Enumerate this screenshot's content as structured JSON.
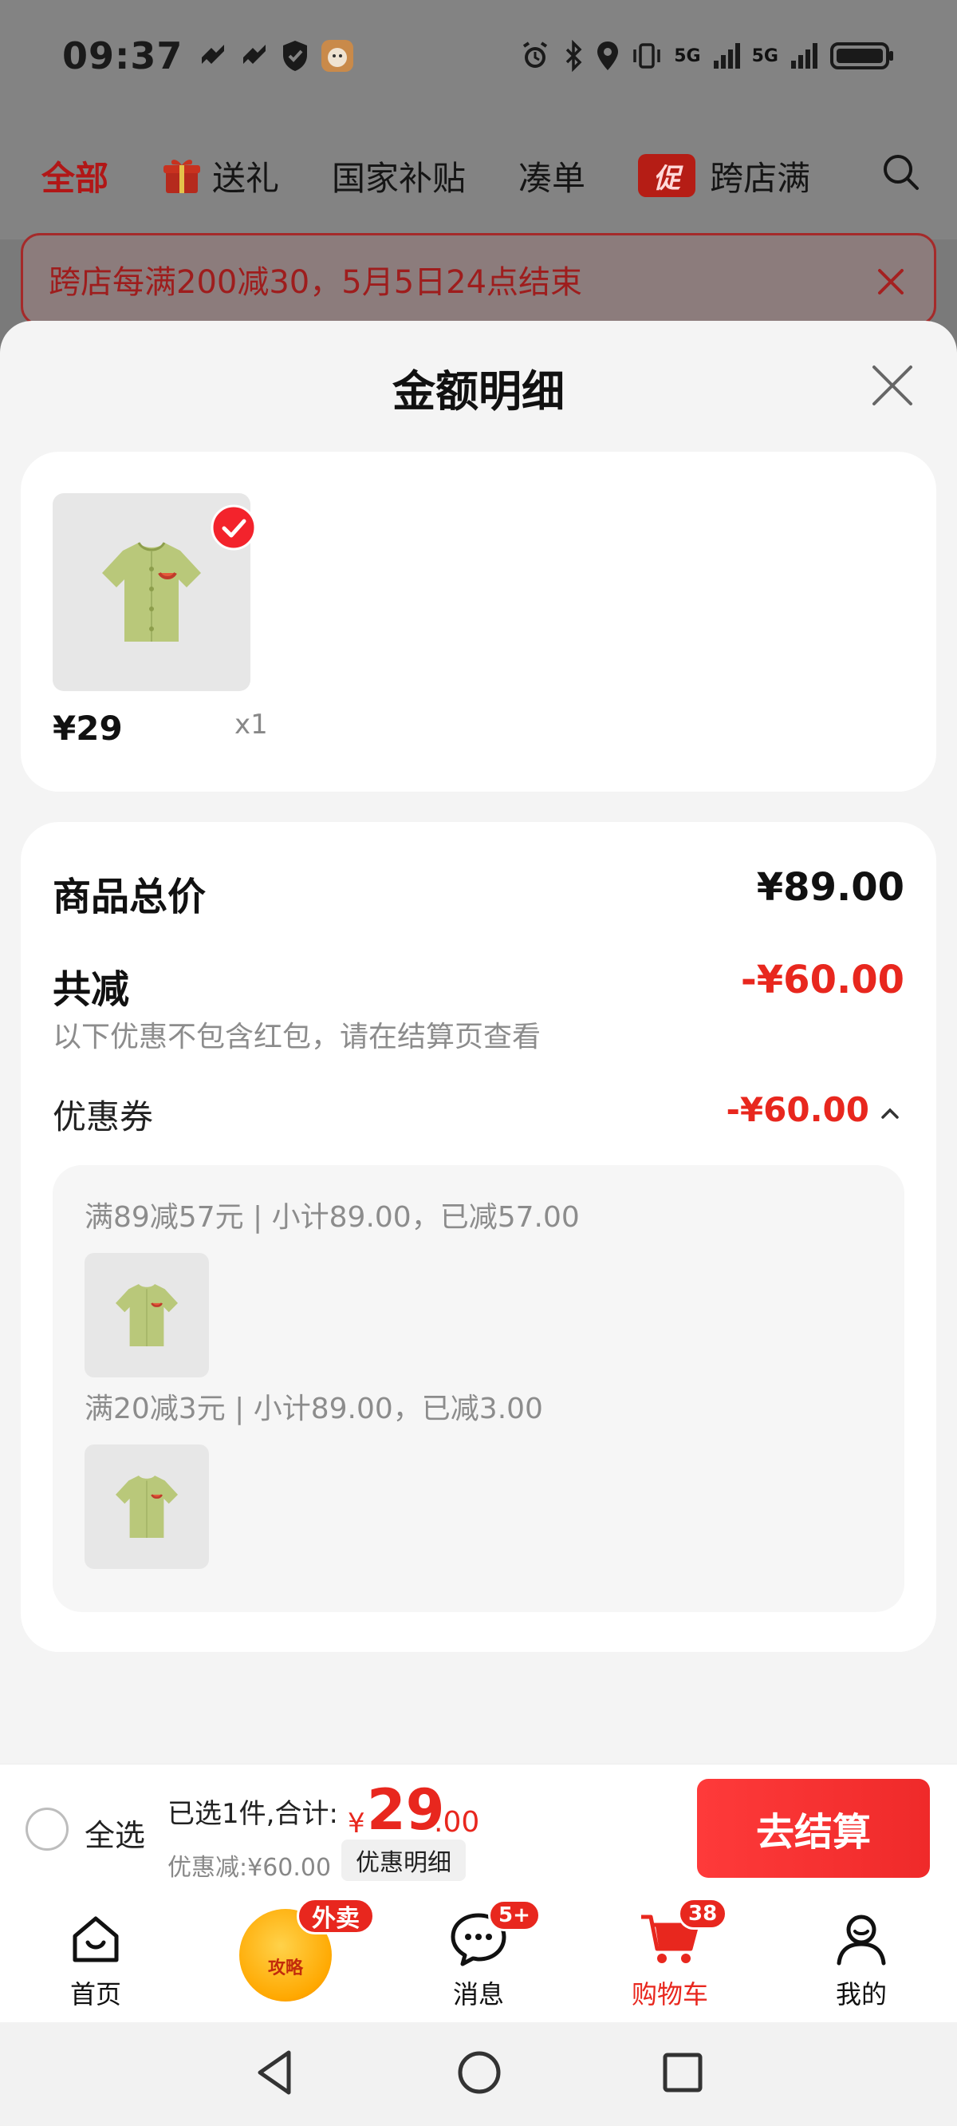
{
  "status_bar": {
    "time": "09:37",
    "network_1": "5G",
    "network_2": "5G"
  },
  "tabs": [
    {
      "label": "全部",
      "active": true
    },
    {
      "label": "送礼",
      "icon": "gift-icon"
    },
    {
      "label": "国家补贴"
    },
    {
      "label": "凑单"
    },
    {
      "label": "跨店满",
      "badge": "促"
    }
  ],
  "promo_banner": {
    "text": "跨店每满200减30，5月5日24点结束"
  },
  "sheet": {
    "title": "金额明细"
  },
  "product": {
    "price": "¥29",
    "quantity": "x1",
    "selected": true
  },
  "summary": {
    "total_label": "商品总价",
    "total_value": "¥89.00",
    "discount_label": "共减",
    "discount_value": "-¥60.00",
    "note": "以下优惠不包含红包，请在结算页查看",
    "coupon_label": "优惠券",
    "coupon_value": "-¥60.00"
  },
  "coupon_details": [
    {
      "rule": "满89减57元 | 小计89.00，已减57.00"
    },
    {
      "rule": "满20减3元 | 小计89.00，已减3.00"
    }
  ],
  "checkout": {
    "select_all_label": "全选",
    "selected_summary": "已选1件,合计:",
    "currency": "¥",
    "total_int": "29",
    "total_dec": ".00",
    "discount_summary": "优惠减:¥60.00",
    "detail_button": "优惠明细",
    "checkout_button": "去结算"
  },
  "bottom_nav": {
    "home": "首页",
    "promo_lantern_text": "攻略",
    "takeout_badge": "外卖",
    "messages": "消息",
    "messages_badge": "5+",
    "cart": "购物车",
    "cart_badge": "38",
    "mine": "我的"
  },
  "colors": {
    "accent_red": "#e8271e",
    "product_green": "#b9c87a"
  }
}
